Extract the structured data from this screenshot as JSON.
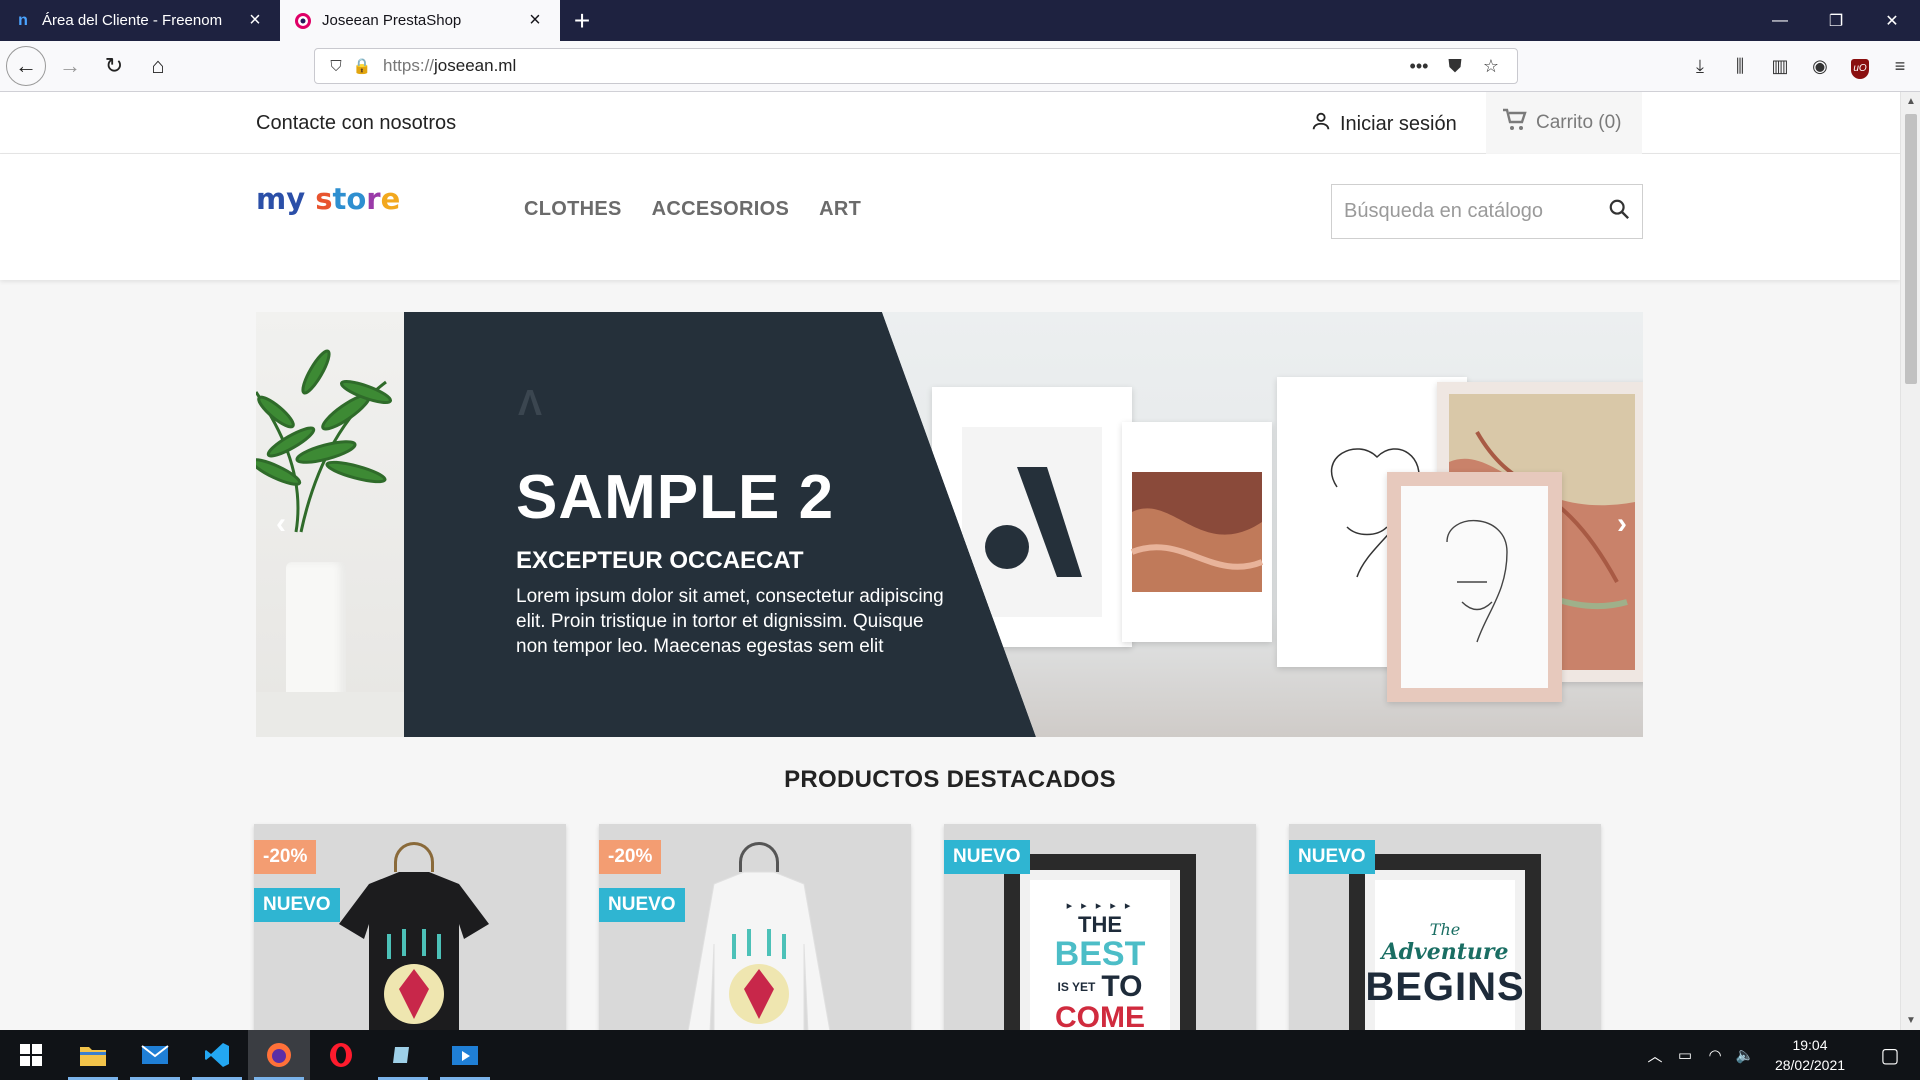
{
  "browser": {
    "tabs": [
      {
        "title": "Área del Cliente - Freenom",
        "favicon": "n",
        "active": false
      },
      {
        "title": "Joseean PrestaShop",
        "favicon": "prestashop-icon",
        "active": true
      }
    ],
    "new_tab": "+",
    "window_controls": {
      "minimize": "—",
      "restore": "❐",
      "close": "✕"
    },
    "url_protocol": "https://",
    "url_host": "joseean.ml",
    "nav_icons": {
      "back": "←",
      "forward": "→",
      "reload": "↻",
      "home": "⌂"
    }
  },
  "shop": {
    "topbar": {
      "contact": "Contacte con nosotros",
      "signin": "Iniciar sesión",
      "cart": "Carrito (0)"
    },
    "logo": {
      "part1": "my",
      "part2": "s",
      "part3": "to",
      "part4": "r",
      "part5": "e"
    },
    "menu": [
      "CLOTHES",
      "ACCESORIOS",
      "ART"
    ],
    "search_placeholder": "Búsqueda en catálogo",
    "slide": {
      "title": "SAMPLE 2",
      "subtitle": "EXCEPTEUR OCCAECAT",
      "text": "Lorem ipsum dolor sit amet, consectetur adipiscing elit. Proin tristique in tortor et dignissim. Quisque non tempor leo. Maecenas egestas sem elit"
    },
    "section_title": "PRODUCTOS DESTACADOS",
    "products": [
      {
        "discount": "-20%",
        "new": "NUEVO",
        "kind": "black-tshirt"
      },
      {
        "discount": "-20%",
        "new": "NUEVO",
        "kind": "white-sweater"
      },
      {
        "discount": "",
        "new": "NUEVO",
        "kind": "poster-best",
        "poster": {
          "line1": "▸ ▸ ▸ ▸ ▸",
          "line2": "THE",
          "line3": "BEST",
          "line4": "IS YET",
          "line5": "TO",
          "line6": "COME"
        }
      },
      {
        "discount": "",
        "new": "NUEVO",
        "kind": "poster-adventure",
        "poster": {
          "line1": "The",
          "line2": "Adventure",
          "line3": "BEGINS"
        }
      }
    ]
  },
  "taskbar": {
    "time": "19:04",
    "date": "28/02/2021"
  },
  "colors": {
    "accent": "#2fb5d2",
    "discount": "#f39d72",
    "slide_panel": "#25303a"
  }
}
